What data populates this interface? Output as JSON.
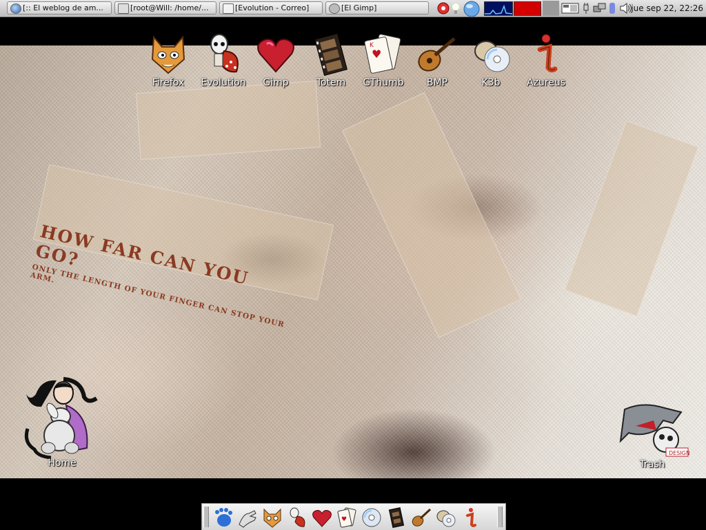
{
  "taskbar": {
    "tasks": [
      {
        "label": "[:: El weblog de am...",
        "icon": "globe-icon"
      },
      {
        "label": "[root@Will: /home/...",
        "icon": "terminal-icon"
      },
      {
        "label": "[Evolution - Correo]",
        "icon": "mail-icon"
      },
      {
        "label": "[El Gimp]",
        "icon": "gimp-icon"
      }
    ],
    "clock": "jue sep 22, 22:26"
  },
  "wallpaper": {
    "headline": "HOW FAR CAN YOU GO?",
    "subline": "ONLY THE LENGTH OF YOUR FINGER CAN STOP YOUR ARM."
  },
  "desktop_icons": [
    {
      "label": "Firefox",
      "icon": "fox-icon"
    },
    {
      "label": "Evolution",
      "icon": "evolution-icon"
    },
    {
      "label": "Gimp",
      "icon": "heart-icon"
    },
    {
      "label": "Totem",
      "icon": "film-icon"
    },
    {
      "label": "GThumb",
      "icon": "cards-icon"
    },
    {
      "label": "BMP",
      "icon": "lute-icon"
    },
    {
      "label": "K3b",
      "icon": "cd-icon"
    },
    {
      "label": "Azureus",
      "icon": "azureus-icon"
    }
  ],
  "home": {
    "label": "Home",
    "icon": "doll-icon"
  },
  "trash": {
    "label": "Trash",
    "icon": "trash-icon"
  },
  "dock": {
    "icons": [
      "gnome-foot-icon",
      "hand-icon",
      "fox-icon",
      "evolution-icon",
      "heart-icon",
      "cards-icon",
      "cd-icon",
      "film-icon",
      "lute-icon",
      "k3b-icon",
      "azureus-icon"
    ]
  }
}
